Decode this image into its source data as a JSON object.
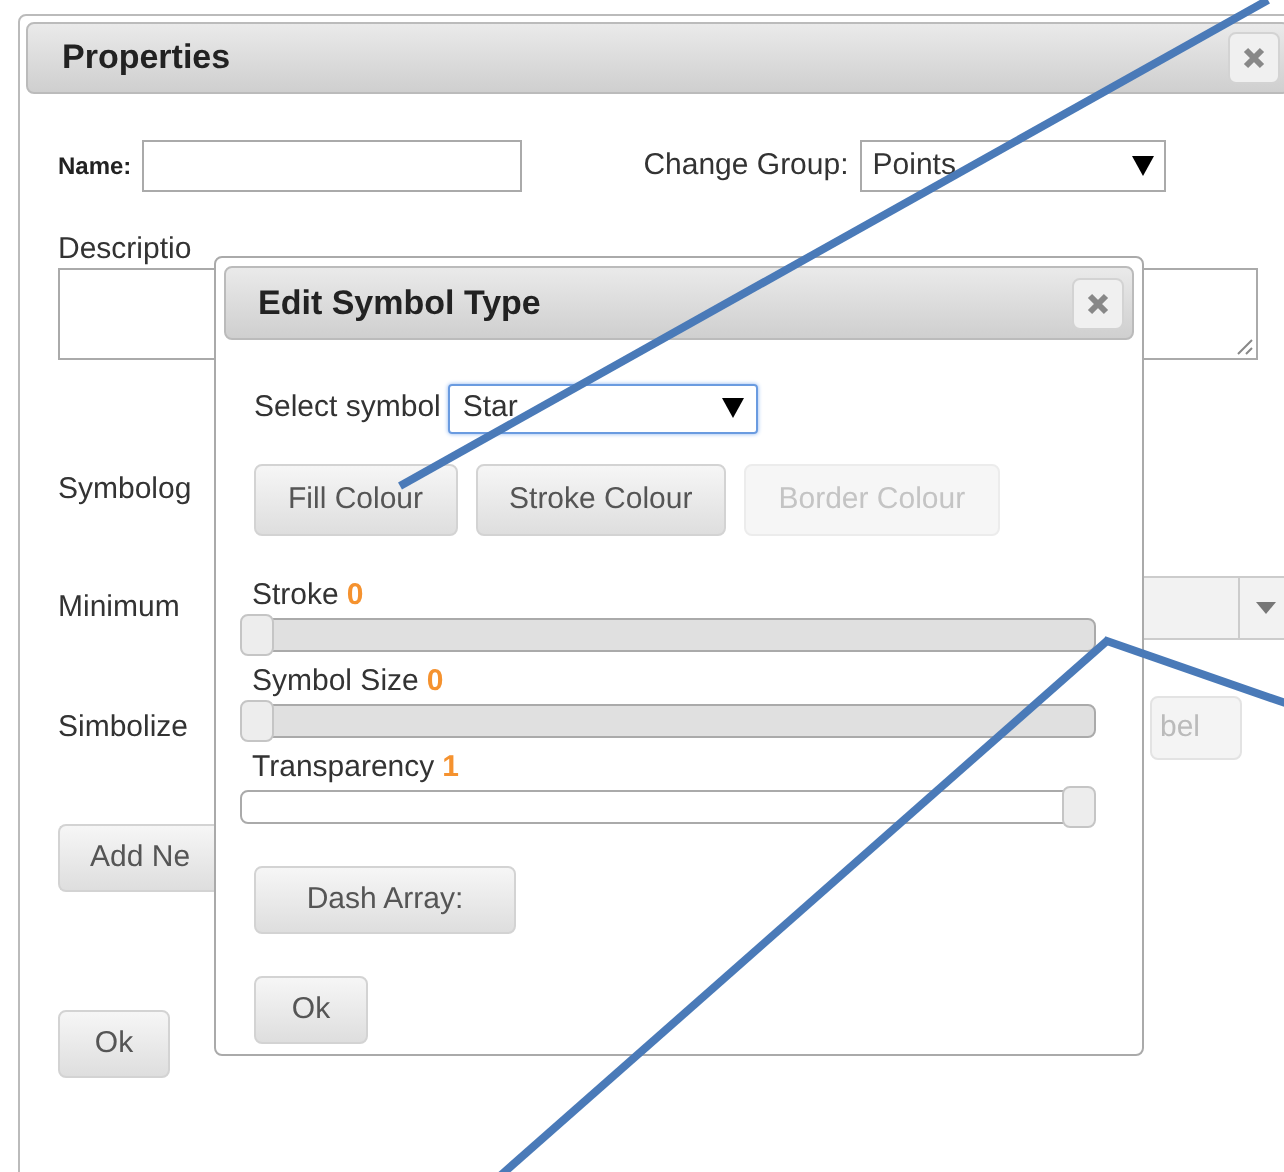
{
  "properties_dialog": {
    "title": "Properties",
    "name_label": "Name:",
    "change_group_label": "Change Group:",
    "change_group_value": "Points",
    "description_label": "Descriptio",
    "symbology_label": "Symbolog",
    "minimum_label": "Minimum",
    "simbolize_label": "Simbolize",
    "label_button": {
      "label": "bel",
      "disabled": true
    },
    "add_button": "Add Ne",
    "ok_button": "Ok"
  },
  "edit_symbol_dialog": {
    "title": "Edit Symbol Type",
    "select_label": "Select symbol",
    "select_value": "Star",
    "select_focused": true,
    "colour_buttons": [
      {
        "label": "Fill Colour",
        "disabled": false
      },
      {
        "label": "Stroke Colour",
        "disabled": false
      },
      {
        "label": "Border Colour",
        "disabled": true
      }
    ],
    "sliders": [
      {
        "label": "Stroke",
        "reading": "0",
        "level": 0,
        "track_shaded": true
      },
      {
        "label": "Symbol Size",
        "reading": "0",
        "level": 0,
        "track_shaded": true
      },
      {
        "label": "Transparency",
        "reading": "1",
        "level": 1,
        "track_shaded": false
      }
    ],
    "dash_button": "Dash Array:",
    "ok_button": "Ok"
  }
}
